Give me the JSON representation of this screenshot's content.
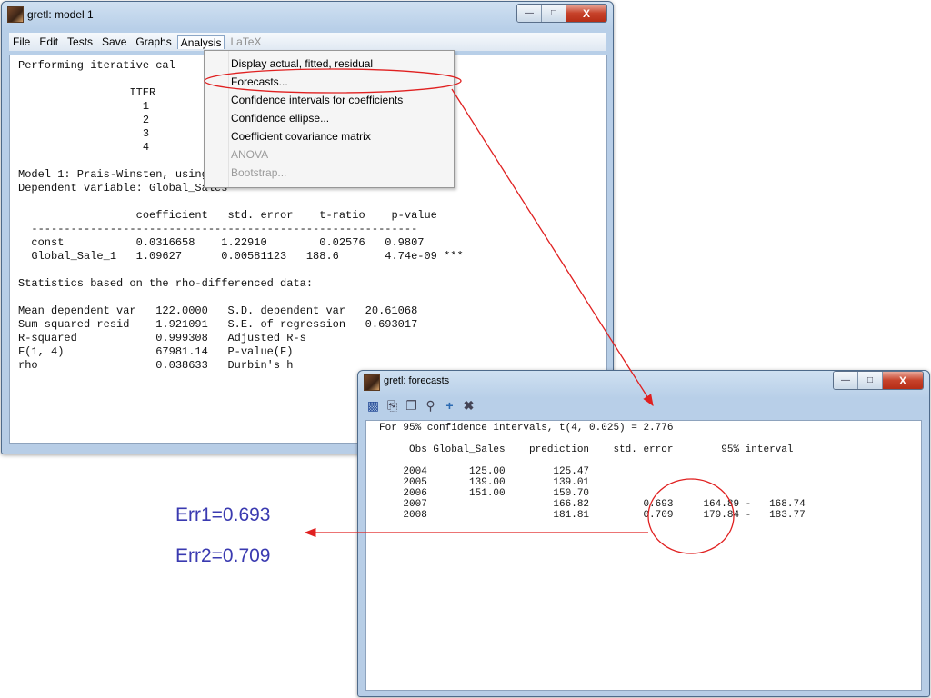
{
  "window1": {
    "title": "gretl: model 1",
    "menu": [
      "File",
      "Edit",
      "Tests",
      "Save",
      "Graphs",
      "Analysis",
      "LaTeX"
    ],
    "text": "Performing iterative cal\n\n                 ITER\n                   1\n                   2\n                   3\n                   4\n\nModel 1: Prais-Winsten, using observations 2001-2006 (T = 6)\nDependent variable: Global_Sales\n\n                  coefficient   std. error    t-ratio    p-value\n  -----------------------------------------------------------\n  const           0.0316658    1.22910        0.02576   0.9807\n  Global_Sale_1   1.09627      0.00581123   188.6       4.74e-09 ***\n\nStatistics based on the rho-differenced data:\n\nMean dependent var   122.0000   S.D. dependent var   20.61068\nSum squared resid    1.921091   S.E. of regression   0.693017\nR-squared            0.999308   Adjusted R-s\nF(1, 4)              67981.14   P-value(F)\nrho                  0.038633   Durbin's h"
  },
  "analysis_menu": {
    "items": [
      {
        "label": "Display actual, fitted, residual",
        "disabled": false
      },
      {
        "label": "Forecasts...",
        "disabled": false
      },
      {
        "label": "Confidence intervals for coefficients",
        "disabled": false
      },
      {
        "label": "Confidence ellipse...",
        "disabled": false
      },
      {
        "label": "Coefficient covariance matrix",
        "disabled": false
      },
      {
        "label": "ANOVA",
        "disabled": true
      },
      {
        "label": "Bootstrap...",
        "disabled": true
      }
    ]
  },
  "window2": {
    "title": "gretl: forecasts",
    "toolbar_icons": [
      "save-icon",
      "print-icon",
      "copy-icon",
      "find-icon",
      "add-icon",
      "close-icon"
    ],
    "text": "For 95% confidence intervals, t(4, 0.025) = 2.776\n\n     Obs Global_Sales    prediction    std. error        95% interval\n\n    2004       125.00        125.47\n    2005       139.00        139.01\n    2006       151.00        150.70\n    2007                     166.82         0.693     164.89 -   168.74\n    2008                     181.81         0.709     179.84 -   183.77"
  },
  "annotations": {
    "err1": "Err1=0.693",
    "err2": "Err2=0.709",
    "accent_color": "#e02020"
  }
}
